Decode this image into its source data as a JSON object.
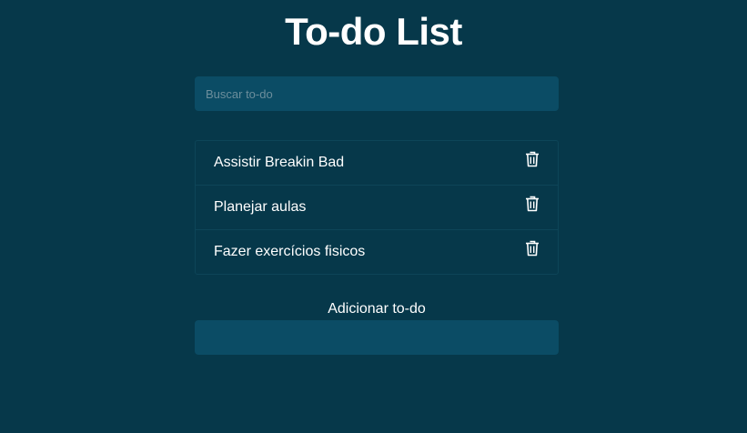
{
  "header": {
    "title": "To-do List"
  },
  "search": {
    "placeholder": "Buscar to-do",
    "value": ""
  },
  "todos": [
    {
      "text": "Assistir Breakin Bad",
      "action_icon": "trash-icon"
    },
    {
      "text": "Planejar aulas",
      "action_icon": "trash-icon"
    },
    {
      "text": "Fazer exercícios fisicos",
      "action_icon": "trash-icon"
    }
  ],
  "add_form": {
    "label": "Adicionar to-do",
    "value": ""
  },
  "colors": {
    "background": "#06384a",
    "input_background": "#0b4c65",
    "item_border": "#0d4558",
    "text": "#ffffff"
  }
}
